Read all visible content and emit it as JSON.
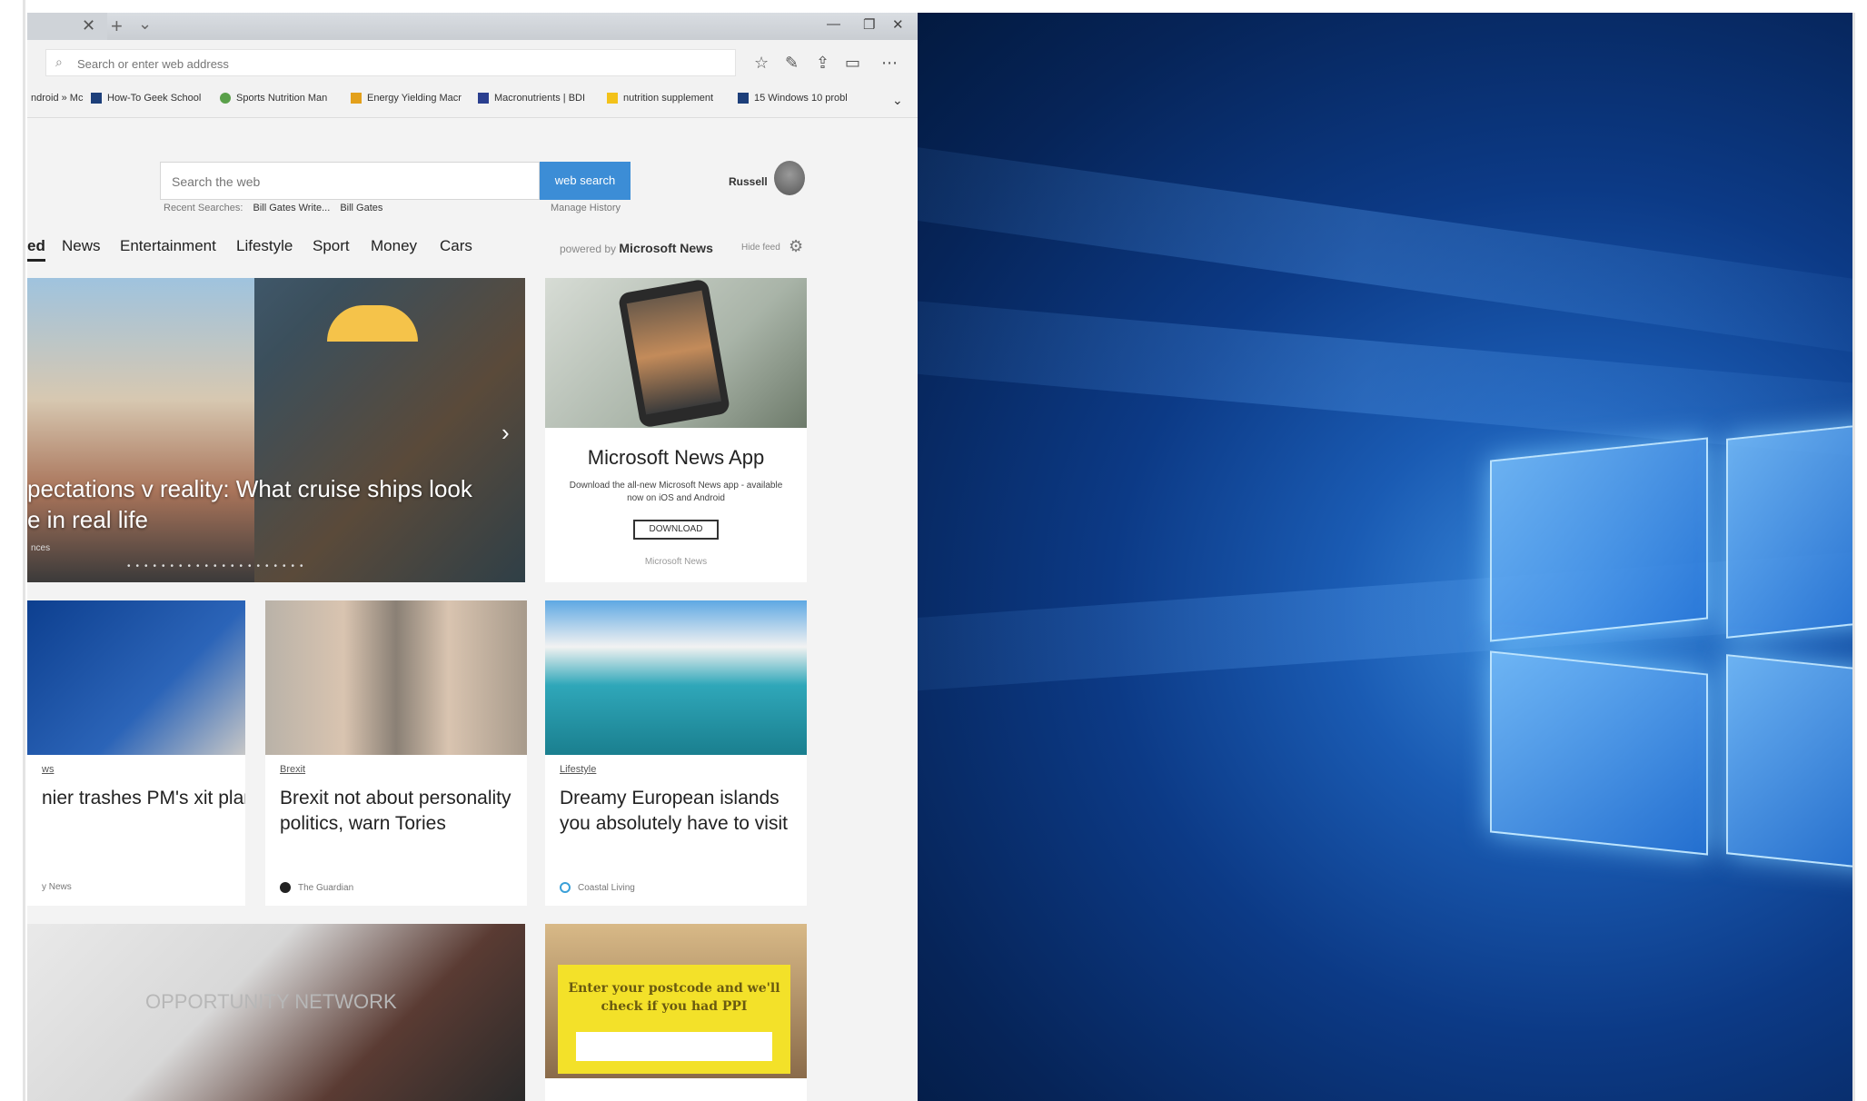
{
  "browser": {
    "address_placeholder": "Search or enter web address",
    "favorites": [
      {
        "label": "ndroid » Mc",
        "color": ""
      },
      {
        "label": "How-To Geek School",
        "color": "#1d3f7a"
      },
      {
        "label": "Sports Nutrition Man",
        "color": "#5aa04a"
      },
      {
        "label": "Energy Yielding Macr",
        "color": "#e3a01b"
      },
      {
        "label": "Macronutrients | BDI",
        "color": "#2b3f8f"
      },
      {
        "label": "nutrition supplement",
        "color": "#f3c21a"
      },
      {
        "label": "15 Windows 10 probl",
        "color": "#1d3f7a"
      }
    ]
  },
  "page": {
    "search_placeholder": "Search the web",
    "search_button": "web search",
    "recent_label": "Recent Searches:",
    "recent_items": [
      "Bill Gates Write...",
      "Bill Gates"
    ],
    "manage_history": "Manage History",
    "user_name": "Russell",
    "tabs": [
      "ed",
      "News",
      "Entertainment",
      "Lifestyle",
      "Sport",
      "Money",
      "Cars"
    ],
    "powered_prefix": "powered by",
    "powered_brand": "Microsoft News",
    "hide_feed": "Hide feed",
    "hero_caption": "pectations v reality: What cruise ships look e in real life",
    "hero_source": "nces",
    "ad": {
      "title": "Microsoft News App",
      "desc": "Download the all-new Microsoft News app - available now on iOS and Android",
      "button": "DOWNLOAD",
      "source": "Microsoft News"
    },
    "news": [
      {
        "category": "ws",
        "headline": "nier trashes PM's xit plan",
        "source": "y News",
        "icon_color": "#999999"
      },
      {
        "category": "Brexit",
        "headline": "Brexit not about personality politics, warn Tories",
        "source": "The Guardian",
        "icon_color": "#222222"
      },
      {
        "category": "Lifestyle",
        "headline": "Dreamy European islands you absolutely have to visit",
        "source": "Coastal Living",
        "icon_color": "#3aa0d8"
      }
    ],
    "bottom_watermark": "OPPORTUNITY NETWORK",
    "ppi_text": "Enter your postcode and we'll check if you had PPI"
  },
  "colors": {
    "accent": "#3c8dd6",
    "desktop_blue": "#0c3a86"
  }
}
